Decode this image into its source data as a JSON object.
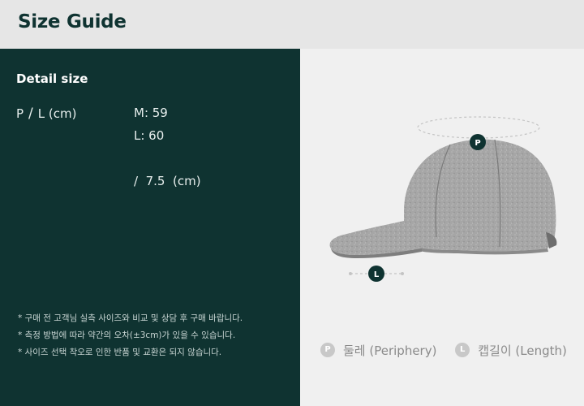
{
  "header": {
    "title": "Size Guide"
  },
  "detail": {
    "title": "Detail size",
    "row_label": {
      "p": "P",
      "sep": "/",
      "l": "L (cm)"
    },
    "values": {
      "m": "M: 59",
      "l": "L: 60",
      "length": "/  7.5  (cm)"
    },
    "notes": [
      "* 구매 전 고객님 실측 사이즈와 비교 및 상담 후 구매 바랍니다.",
      "* 측정 방법에 따라 약간의 오차(±3cm)가 있을 수 있습니다.",
      "* 사이즈 선택 착오로 인한 반품 및 교환은 되지 않습니다."
    ]
  },
  "diagram": {
    "markers": {
      "p": "P",
      "l": "L"
    },
    "legend": [
      {
        "badge": "P",
        "label": "둘레 (Periphery)"
      },
      {
        "badge": "L",
        "label": "캡길이 (Length)"
      }
    ]
  },
  "colors": {
    "primary_dark": "#0f3331",
    "header_bg": "#e6e6e6",
    "right_bg": "#f0f0f0",
    "cap_gray": "#a4a4a4"
  }
}
